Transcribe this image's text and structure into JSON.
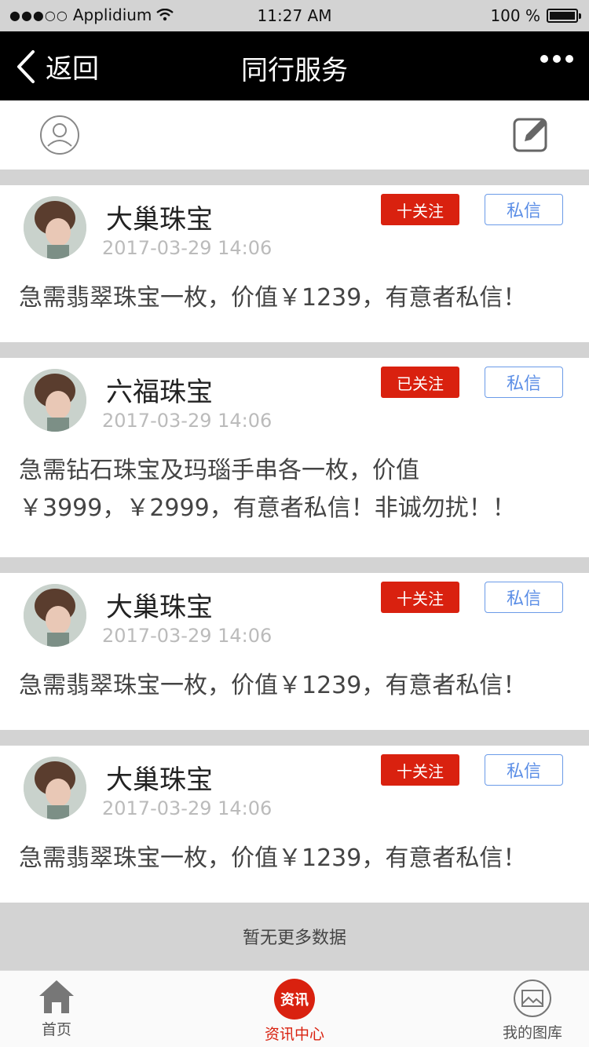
{
  "status_bar": {
    "carrier": "Applidium",
    "time": "11:27 AM",
    "battery_text": "100 %",
    "battery_level": 1.0
  },
  "nav": {
    "back_label": "返回",
    "title": "同行服务"
  },
  "posts": [
    {
      "name": "大巢珠宝",
      "time": "2017-03-29 14:06",
      "follow_label": "十关注",
      "message_label": "私信",
      "content": "急需翡翠珠宝一枚，价值￥1239，有意者私信！"
    },
    {
      "name": "六福珠宝",
      "time": "2017-03-29 14:06",
      "follow_label": "已关注",
      "message_label": "私信",
      "content": "急需钻石珠宝及玛瑙手串各一枚，价值￥3999，￥2999，有意者私信！非诚勿扰！！"
    },
    {
      "name": "大巢珠宝",
      "time": "2017-03-29 14:06",
      "follow_label": "十关注",
      "message_label": "私信",
      "content": "急需翡翠珠宝一枚，价值￥1239，有意者私信！"
    },
    {
      "name": "大巢珠宝",
      "time": "2017-03-29 14:06",
      "follow_label": "十关注",
      "message_label": "私信",
      "content": "急需翡翠珠宝一枚，价值￥1239，有意者私信！"
    }
  ],
  "no_more": "暂无更多数据",
  "tabs": [
    {
      "label": "首页",
      "icon": "home-icon"
    },
    {
      "label": "资讯中心",
      "icon_text": "资讯",
      "icon": "news-icon",
      "active": true
    },
    {
      "label": "我的图库",
      "icon": "gallery-icon"
    }
  ],
  "colors": {
    "accent": "#d9210f",
    "message_blue": "#5b8ee6",
    "nav_bg": "#000000"
  }
}
